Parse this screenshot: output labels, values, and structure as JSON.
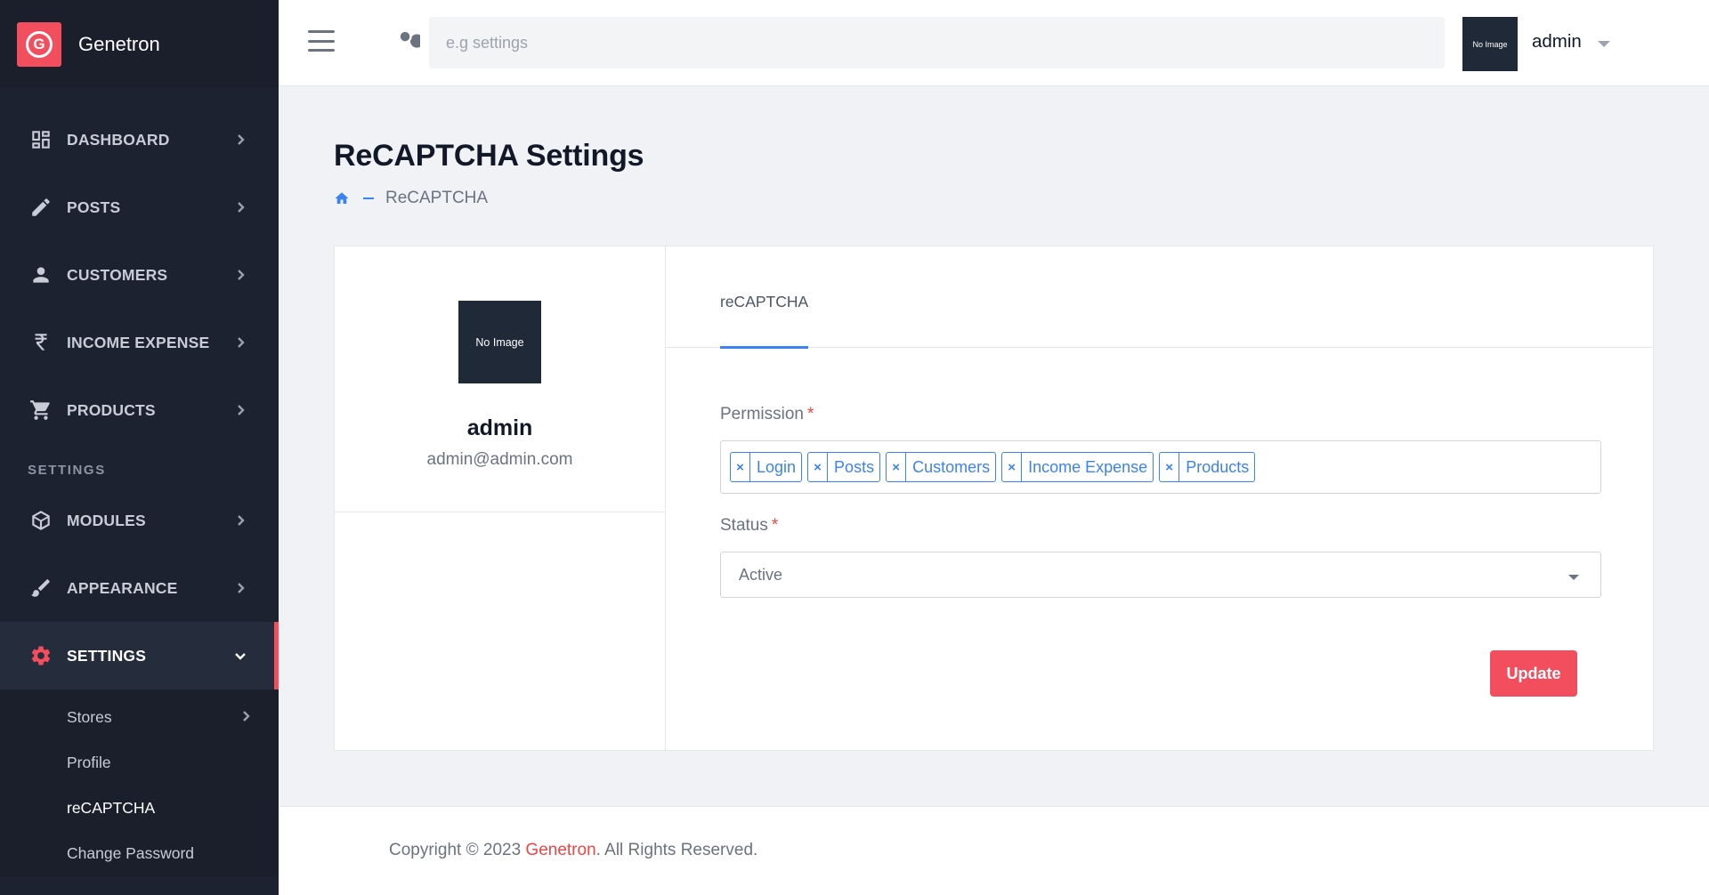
{
  "brand": {
    "logo_letter": "G",
    "name": "Genetron"
  },
  "sidebar": {
    "items": [
      {
        "label": "DASHBOARD",
        "icon": "dashboard-icon"
      },
      {
        "label": "POSTS",
        "icon": "pencil-icon"
      },
      {
        "label": "CUSTOMERS",
        "icon": "person-icon"
      },
      {
        "label": "INCOME EXPENSE",
        "icon": "rupee-icon"
      },
      {
        "label": "PRODUCTS",
        "icon": "cart-icon"
      }
    ],
    "section_title": "SETTINGS",
    "settings_items": [
      {
        "label": "MODULES",
        "icon": "cube-icon"
      },
      {
        "label": "APPEARANCE",
        "icon": "brush-icon"
      },
      {
        "label": "SETTINGS",
        "icon": "gear-icon"
      }
    ],
    "sub_items": [
      {
        "label": "Stores"
      },
      {
        "label": "Profile"
      },
      {
        "label": "reCAPTCHA"
      },
      {
        "label": "Change Password"
      }
    ]
  },
  "topbar": {
    "search_placeholder": "e.g settings",
    "avatar_text": "No Image",
    "username": "admin"
  },
  "page": {
    "title": "ReCAPTCHA Settings",
    "breadcrumb_current": "ReCAPTCHA"
  },
  "profile": {
    "image_text": "No Image",
    "name": "admin",
    "email": "admin@admin.com"
  },
  "form": {
    "tab_label": "reCAPTCHA",
    "permission_label": "Permission",
    "required_mark": "*",
    "tag_remove": "×",
    "permission_tags": [
      "Login",
      "Posts",
      "Customers",
      "Income Expense",
      "Products"
    ],
    "status_label": "Status",
    "status_value": "Active",
    "update_button": "Update"
  },
  "footer": {
    "prefix": "Copyright © 2023 ",
    "brand": "Genetron",
    "suffix": ". All Rights Reserved."
  },
  "colors": {
    "accent": "#f24e5e",
    "primary": "#3b82f6",
    "sidebar_bg": "#1c2230"
  }
}
